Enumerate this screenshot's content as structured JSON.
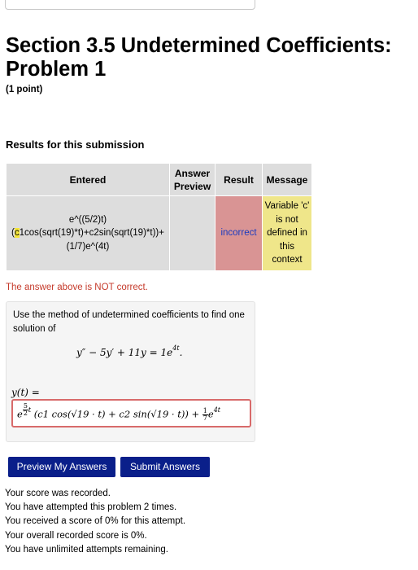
{
  "title": "Section 3.5 Undetermined Coefficients: Problem 1",
  "points": "(1 point)",
  "results_heading": "Results for this submission",
  "table": {
    "headers": {
      "entered": "Entered",
      "preview": "Answer Preview",
      "result": "Result",
      "message": "Message"
    },
    "row": {
      "entered_line1": "e^((5/2)t)",
      "entered_highlight": "c",
      "entered_line2_rest": "1cos(sqrt(19)*t)+c2sin(sqrt(19)*t))+",
      "entered_line2_prefix": "(",
      "entered_line3": "(1/7)e^(4t)",
      "preview": "",
      "result": "incorrect",
      "message": "Variable 'c' is not defined in this context"
    }
  },
  "not_correct_text": "The answer above is NOT correct.",
  "problem": {
    "instruction": "Use the method of undetermined coefficients to find one solution of",
    "equation": "y″ − 5y′ + 11y = 1e",
    "equation_exp": "4t",
    "answer_label": "y(t) =",
    "answer_math": {
      "base": "e",
      "exp_num": "5",
      "exp_den": "2",
      "exp_var": "t",
      "body": "(c1 cos(√19 · t) + c2 sin(√19 · t)) + ",
      "frac_num": "1",
      "frac_den": "7",
      "tail_base": "e",
      "tail_exp": "4t"
    }
  },
  "buttons": {
    "preview": "Preview My Answers",
    "submit": "Submit Answers"
  },
  "status_lines": [
    "Your score was recorded.",
    "You have attempted this problem 2 times.",
    "You received a score of 0% for this attempt.",
    "Your overall recorded score is 0%.",
    "You have unlimited attempts remaining."
  ],
  "colors": {
    "button": "#0a1f8a",
    "incorrect_cell": "#d99494",
    "message_cell": "#efe68a",
    "error_text": "#c53a2b"
  }
}
